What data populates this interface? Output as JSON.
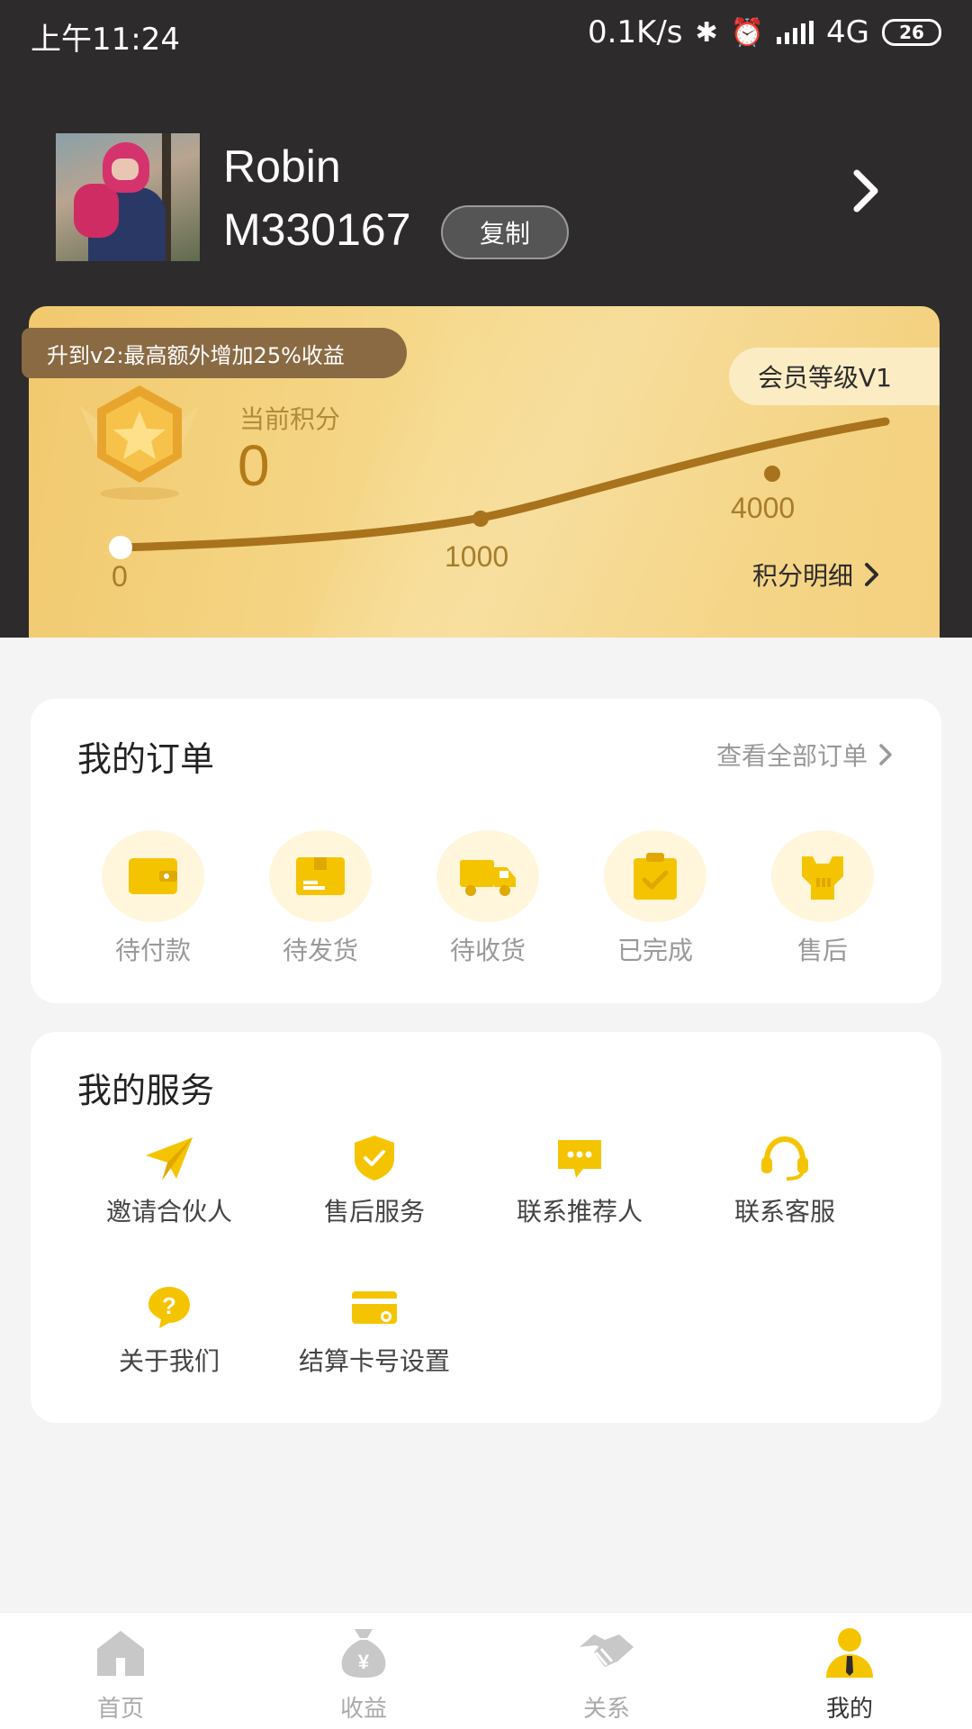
{
  "status_bar": {
    "time": "上午11:24",
    "speed": "0.1K/s",
    "network": "4G",
    "battery": "26"
  },
  "profile": {
    "name": "Robin",
    "id": "M330167",
    "copy_label": "复制"
  },
  "level_card": {
    "upgrade_banner": "升到v2:最高额外增加25%收益",
    "member_level": "会员等级V1",
    "points_label": "当前积分",
    "points_value": "0",
    "ticks": [
      "0",
      "1000",
      "4000"
    ],
    "detail_link": "积分明细"
  },
  "orders": {
    "title": "我的订单",
    "view_all": "查看全部订单",
    "items": [
      {
        "label": "待付款",
        "icon": "wallet-icon"
      },
      {
        "label": "待发货",
        "icon": "package-icon"
      },
      {
        "label": "待收货",
        "icon": "truck-icon"
      },
      {
        "label": "已完成",
        "icon": "clipboard-check-icon"
      },
      {
        "label": "售后",
        "icon": "wrench-icon"
      }
    ]
  },
  "services": {
    "title": "我的服务",
    "items": [
      {
        "label": "邀请合伙人",
        "icon": "paper-plane-icon"
      },
      {
        "label": "售后服务",
        "icon": "shield-check-icon"
      },
      {
        "label": "联系推荐人",
        "icon": "chat-bubble-icon"
      },
      {
        "label": "联系客服",
        "icon": "headset-icon"
      },
      {
        "label": "关于我们",
        "icon": "question-icon"
      },
      {
        "label": "结算卡号设置",
        "icon": "card-icon"
      }
    ]
  },
  "tab_bar": {
    "tabs": [
      {
        "label": "首页",
        "icon": "home-icon"
      },
      {
        "label": "收益",
        "icon": "money-bag-icon"
      },
      {
        "label": "关系",
        "icon": "handshake-icon"
      },
      {
        "label": "我的",
        "icon": "person-icon"
      }
    ],
    "active": "我的"
  },
  "colors": {
    "header_bg": "#2d2b2b",
    "accent_yellow": "#f5c400",
    "gold": "#b47a17"
  }
}
